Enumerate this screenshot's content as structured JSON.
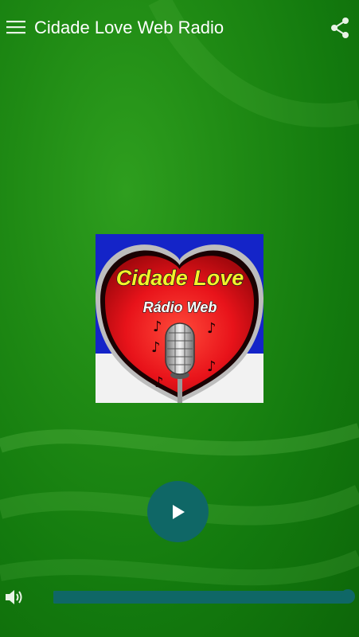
{
  "app_bar": {
    "title": "Cidade Love Web Radio",
    "menu_icon": "hamburger-menu-icon",
    "share_icon": "share-icon"
  },
  "logo": {
    "title": "Cidade Love",
    "subtitle": "Rádio Web",
    "heart_color": "#e8131a",
    "title_color": "#f4f22a"
  },
  "player": {
    "play_icon": "play-icon",
    "button_color": "#0f6766"
  },
  "volume": {
    "icon": "volume-icon",
    "level": 1.0
  },
  "colors": {
    "background": "#1f8a14",
    "accent": "#0f6766"
  }
}
